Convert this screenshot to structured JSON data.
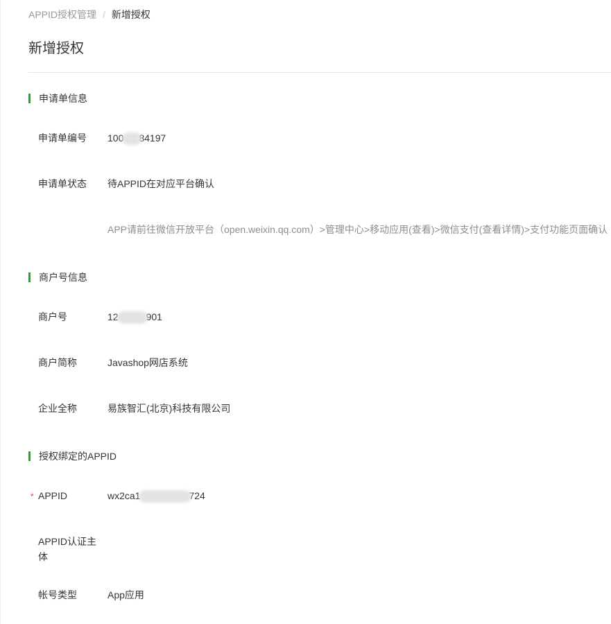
{
  "breadcrumb": {
    "parent": "APPID授权管理",
    "separator": "/",
    "current": "新增授权"
  },
  "page_title": "新增授权",
  "sections": {
    "application": {
      "title": "申请单信息",
      "number_label": "申请单编号",
      "number_prefix": "100",
      "number_suffix": "84197",
      "status_label": "申请单状态",
      "status_value": "待APPID在对应平台确认",
      "status_tip": "APP请前往微信开放平台（open.weixin.qq.com）>管理中心>移动应用(查看)>微信支付(查看详情)>支付功能页面确认"
    },
    "merchant": {
      "title": "商户号信息",
      "id_label": "商户号",
      "id_prefix": "12",
      "id_suffix": "901",
      "short_name_label": "商户简称",
      "short_name_value": "Javashop网店系统",
      "full_name_label": "企业全称",
      "full_name_value": "易族智汇(北京)科技有限公司"
    },
    "appid": {
      "title": "授权绑定的APPID",
      "required_mark": "*",
      "appid_label": "APPID",
      "appid_prefix": "wx2ca1",
      "appid_suffix": "724",
      "subject_label": "APPID认证主体",
      "subject_value": "",
      "account_type_label": "帐号类型",
      "account_type_value": "App应用"
    }
  },
  "colors": {
    "accent": "#1aad19",
    "required": "#e64340",
    "text": "#353535",
    "muted": "#9a9a9a"
  }
}
